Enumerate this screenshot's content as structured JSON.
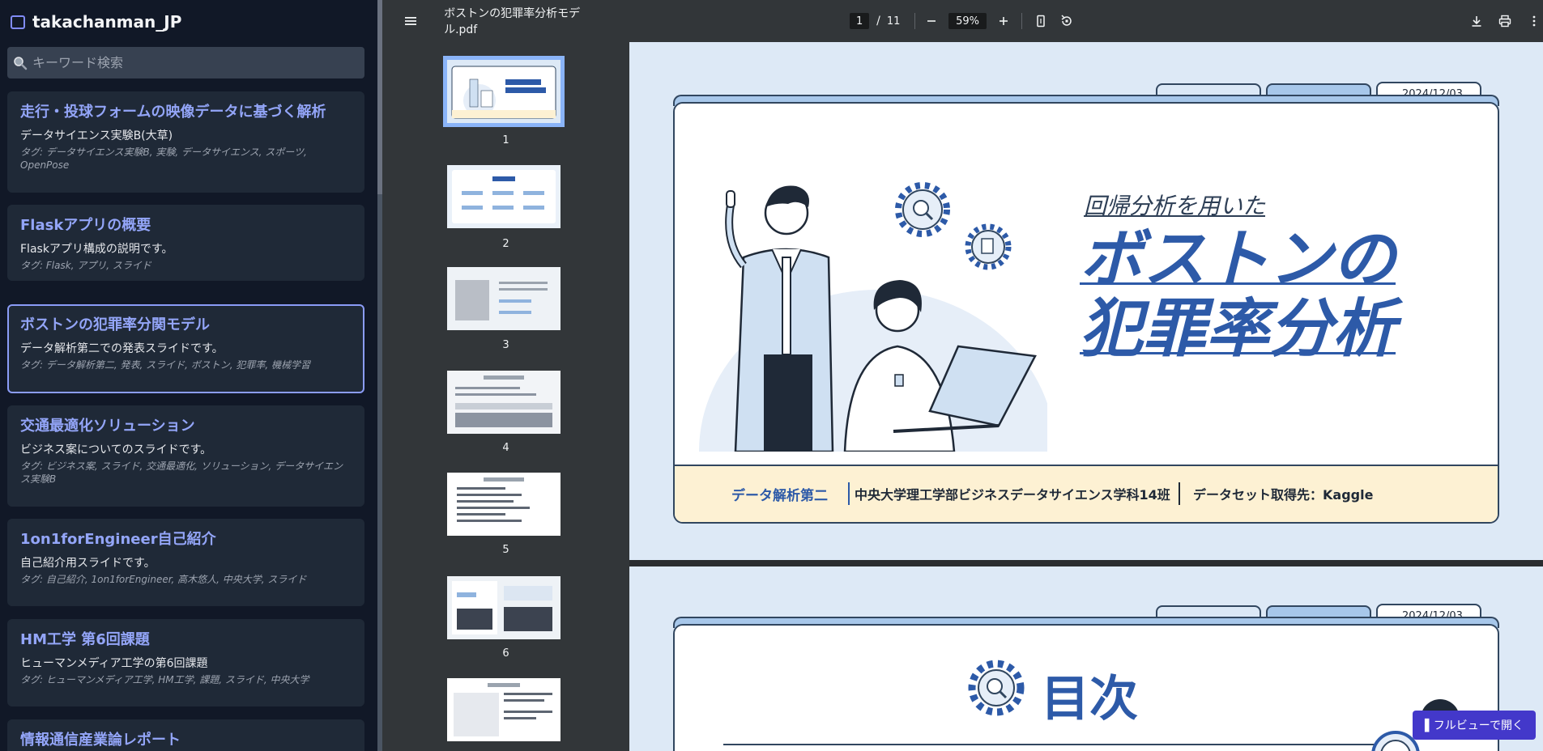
{
  "brand": {
    "name": "takachanman_JP"
  },
  "search": {
    "placeholder": "キーワード検索"
  },
  "cards": [
    {
      "title": "走行・投球フォームの映像データに基づく解析",
      "desc": "データサイエンス実験B(大草)",
      "tags": "タグ: データサイエンス実験B, 実験, データサイエンス, スポーツ, OpenPose"
    },
    {
      "title": "Flaskアプリの概要",
      "desc": "Flaskアプリ構成の説明です。",
      "tags": "タグ: Flask, アプリ, スライド"
    },
    {
      "title": "ボストンの犯罪率分関モデル",
      "desc": "データ解析第二での発表スライドです。",
      "tags": "タグ: データ解析第二, 発表, スライド, ボストン, 犯罪率, 機械学習"
    },
    {
      "title": "交通最適化ソリューション",
      "desc": "ビジネス案についてのスライドです。",
      "tags": "タグ: ビジネス案, スライド, 交通最適化, ソリューション, データサイエンス実験B"
    },
    {
      "title": "1on1forEngineer自己紹介",
      "desc": "自己紹介用スライドです。",
      "tags": "タグ: 自己紹介, 1on1forEngineer, 高木悠人, 中央大学, スライド"
    },
    {
      "title": "HM工学 第6回課題",
      "desc": "ヒューマンメディア工学の第6回課題",
      "tags": "タグ: ヒューマンメディア工学, HM工学, 課題, スライド, 中央大学"
    },
    {
      "title": "情報通信産業論レポート",
      "desc": "",
      "tags": ""
    }
  ],
  "viewer": {
    "file_name": "ボストンの犯罪率分析モデル.pdf",
    "current_page": "1",
    "page_sep": "/",
    "total_pages": "11",
    "zoom": "59%"
  },
  "thumbnails": [
    "1",
    "2",
    "3",
    "4",
    "5",
    "6"
  ],
  "slide1": {
    "date": "2024/12/03",
    "subtitle": "回帰分析を用いた",
    "title_line1": "ボストンの",
    "title_line2": "犯罪率分析",
    "course": "データ解析第二",
    "team": "中央大学理工学部ビジネスデータサイエンス学科14班",
    "dataset": "データセット取得先：Kaggle"
  },
  "slide2": {
    "date": "2024/12/03",
    "title": "目次"
  },
  "fullview": {
    "label": "▌フルビューで開く"
  },
  "colors": {
    "sidebar_bg": "#111827",
    "card_bg": "#1f2937",
    "accent": "#93a5f8",
    "slide_blue": "#2d5aa8",
    "fullview_btn": "#4338ca"
  },
  "icons": {
    "brand": "folder-icon",
    "search": "search-icon",
    "menu": "menu-icon",
    "zoom_out": "minus-icon",
    "zoom_in": "plus-icon",
    "fit": "fit-page-icon",
    "rotate": "rotate-icon",
    "download": "download-icon",
    "print": "print-icon",
    "more": "more-vert-icon"
  }
}
